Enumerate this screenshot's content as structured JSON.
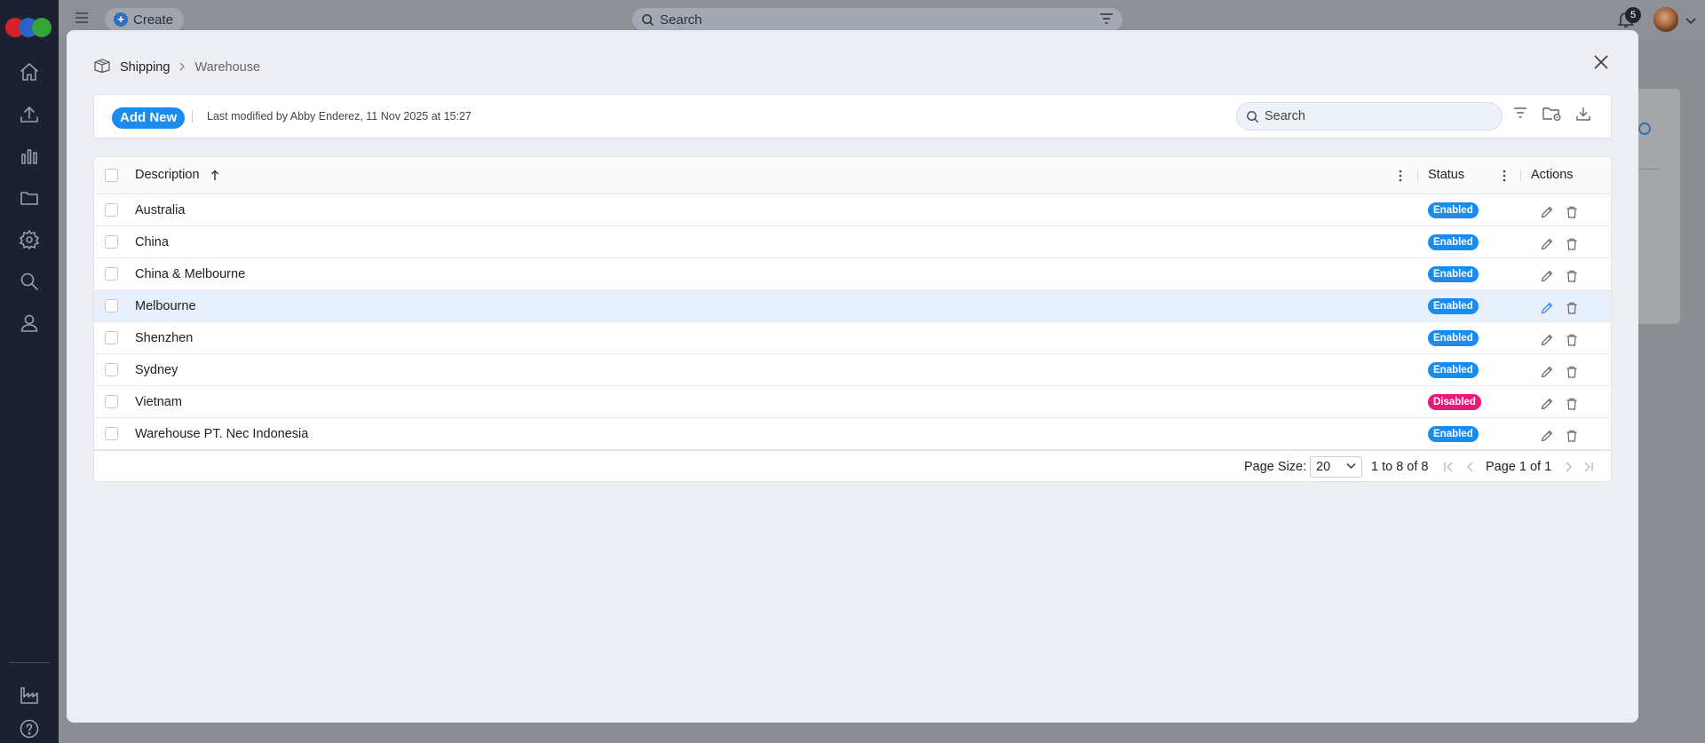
{
  "topbar": {
    "create_label": "Create",
    "search_placeholder": "Search",
    "notification_count": "5"
  },
  "breadcrumb": {
    "root": "Shipping",
    "current": "Warehouse"
  },
  "toolbar": {
    "add_new_label": "Add New",
    "last_modified": "Last modified by Abby Enderez, 11 Nov 2025 at 15:27",
    "search_placeholder": "Search"
  },
  "grid": {
    "columns": {
      "description": "Description",
      "status": "Status",
      "actions": "Actions"
    },
    "rows": [
      {
        "description": "Australia",
        "status": "Enabled"
      },
      {
        "description": "China",
        "status": "Enabled"
      },
      {
        "description": "China & Melbourne",
        "status": "Enabled"
      },
      {
        "description": "Melbourne",
        "status": "Enabled"
      },
      {
        "description": "Shenzhen",
        "status": "Enabled"
      },
      {
        "description": "Sydney",
        "status": "Enabled"
      },
      {
        "description": "Vietnam",
        "status": "Disabled"
      },
      {
        "description": "Warehouse PT. Nec Indonesia",
        "status": "Enabled"
      }
    ]
  },
  "pagination": {
    "page_size_label": "Page Size:",
    "page_size": "20",
    "range": "1 to 8 of 8",
    "page": "Page 1 of 1"
  },
  "colors": {
    "enabled": "#1a8cf0",
    "disabled": "#e8197a",
    "accent": "#1a8cf0",
    "sidebar": "#1c2030"
  },
  "icons": [
    "home-icon",
    "upload-icon",
    "chart-icon",
    "folder-icon",
    "gear-icon",
    "search-icon",
    "user-icon",
    "factory-icon",
    "help-icon",
    "menu-icon",
    "bell-icon",
    "close-icon",
    "box-icon",
    "filter-icon",
    "folder-settings-icon",
    "download-icon",
    "edit-icon",
    "trash-icon"
  ]
}
